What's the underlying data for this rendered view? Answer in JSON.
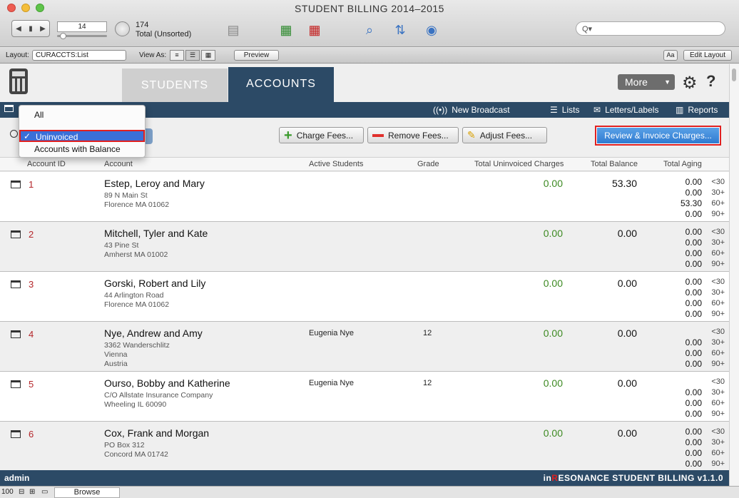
{
  "window": {
    "title": "STUDENT BILLING 2014–2015"
  },
  "toolbar": {
    "record_field": "14",
    "record_count": "174",
    "record_total": "Total (Unsorted)",
    "search_placeholder": "Q▾"
  },
  "layoutbar": {
    "layout_label": "Layout:",
    "layout_value": "CURACCTS:List",
    "view_as_label": "View As:",
    "preview_label": "Preview",
    "aa_label": "Aa",
    "edit_layout_label": "Edit Layout"
  },
  "tabs": [
    {
      "label": "STUDENTS"
    },
    {
      "label": "ACCOUNTS"
    }
  ],
  "more_label": "More",
  "navbar": {
    "new_broadcast": "New Broadcast",
    "lists": "Lists",
    "letters_labels": "Letters/Labels",
    "reports": "Reports"
  },
  "actions": {
    "charge_fees": "Charge Fees...",
    "remove_fees": "Remove Fees...",
    "adjust_fees": "Adjust Fees...",
    "review_invoice": "Review & Invoice Charges..."
  },
  "dropdown": {
    "items": [
      "All",
      "Uninvoiced",
      "Accounts with Balance"
    ],
    "selected": "Uninvoiced"
  },
  "columns": {
    "account_id": "Account ID",
    "account": "Account",
    "active_students": "Active Students",
    "grade": "Grade",
    "total_uninvoiced": "Total Uninvoiced Charges",
    "total_balance": "Total Balance",
    "total_aging": "Total Aging"
  },
  "aging_labels": [
    "<30",
    "30+",
    "60+",
    "90+"
  ],
  "rows": [
    {
      "id": "1",
      "name": "Estep, Leroy and Mary",
      "addr": [
        "89 N Main St",
        "Florence MA 01062"
      ],
      "student": "",
      "grade": "",
      "uninvoiced": "0.00",
      "balance": "53.30",
      "aging": [
        "0.00",
        "0.00",
        "53.30",
        "0.00"
      ]
    },
    {
      "id": "2",
      "name": "Mitchell, Tyler and Kate",
      "addr": [
        "43 Pine St",
        "Amherst MA 01002"
      ],
      "student": "",
      "grade": "",
      "uninvoiced": "0.00",
      "balance": "0.00",
      "aging": [
        "0.00",
        "0.00",
        "0.00",
        "0.00"
      ]
    },
    {
      "id": "3",
      "name": "Gorski, Robert and Lily",
      "addr": [
        "44 Arlington Road",
        "Florence MA 01062"
      ],
      "student": "",
      "grade": "",
      "uninvoiced": "0.00",
      "balance": "0.00",
      "aging": [
        "0.00",
        "0.00",
        "0.00",
        "0.00"
      ]
    },
    {
      "id": "4",
      "name": "Nye, Andrew and Amy",
      "addr": [
        "3362 Wanderschlitz",
        "Vienna",
        "Austria"
      ],
      "student": "Eugenia Nye",
      "grade": "12",
      "uninvoiced": "0.00",
      "balance": "0.00",
      "aging": [
        "",
        "0.00",
        "0.00",
        "0.00"
      ]
    },
    {
      "id": "5",
      "name": "Ourso, Bobby and Katherine",
      "addr": [
        "C/O Allstate Insurance Company",
        "Wheeling IL 60090"
      ],
      "student": "Eugenia Nye",
      "grade": "12",
      "uninvoiced": "0.00",
      "balance": "0.00",
      "aging": [
        "",
        "0.00",
        "0.00",
        "0.00"
      ]
    },
    {
      "id": "6",
      "name": "Cox, Frank and Morgan",
      "addr": [
        "PO Box 312",
        "Concord MA 01742"
      ],
      "student": "",
      "grade": "",
      "uninvoiced": "0.00",
      "balance": "0.00",
      "aging": [
        "0.00",
        "0.00",
        "0.00",
        "0.00"
      ]
    }
  ],
  "footer": {
    "user": "admin",
    "brand_prefix": "in",
    "brand_r": "R",
    "brand_suffix": "ESONANCE STUDENT BILLING v1.1.0"
  },
  "statusbar": {
    "zoom": "100",
    "mode": "Browse"
  }
}
